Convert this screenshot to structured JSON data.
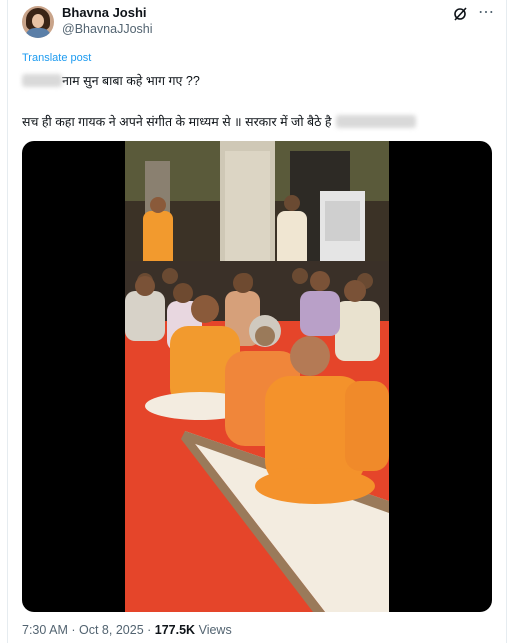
{
  "author": {
    "name": "Bhavna Joshi",
    "handle": "@BhavnaJJoshi"
  },
  "actions": {
    "grok_icon": "grok-icon",
    "more_icon": "more-icon",
    "more_glyph": "⋯"
  },
  "post": {
    "translate_label": "Translate post",
    "line1_text": "नाम सुन  बाबा कहे भाग गए ??",
    "line2_text": "सच ही कहा गायक ने अपने संगीत के माध्यम से ॥ सरकार में जो बैठे है"
  },
  "meta": {
    "time": "7:30 AM",
    "sep1": "·",
    "date": "Oct 8, 2025",
    "sep2": "·",
    "views_count": "177.5K",
    "views_label": "Views"
  },
  "colors": {
    "link": "#1d9bf0",
    "secondary_text": "#536471",
    "primary_text": "#0f1419",
    "carpet": "#e5452a",
    "saffron": "#f29a2e"
  }
}
